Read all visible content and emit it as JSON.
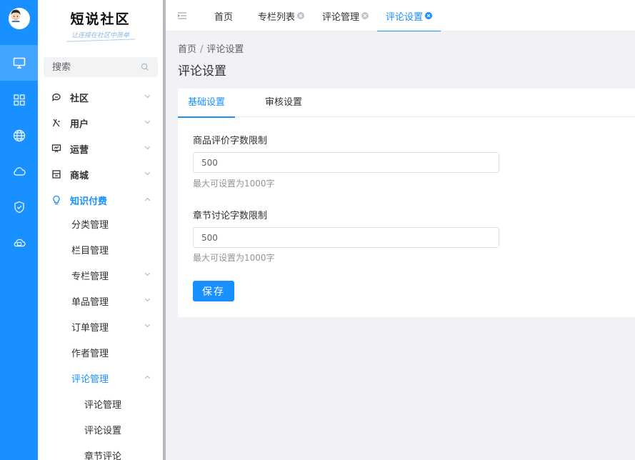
{
  "brand": {
    "title": "短说社区",
    "slogan": "让连接在社区中简单"
  },
  "search": {
    "placeholder": "搜索"
  },
  "menu": {
    "community": "社区",
    "users": "用户",
    "operations": "运营",
    "mall": "商城",
    "knowledge": "知识付费",
    "category_mgmt": "分类管理",
    "column_mgmt": "栏目管理",
    "special_mgmt": "专栏管理",
    "single_mgmt": "单品管理",
    "order_mgmt": "订单管理",
    "author_mgmt": "作者管理",
    "comment_mgmt": "评论管理",
    "comment_mgmt_child": "评论管理",
    "comment_settings": "评论设置",
    "chapter_comments": "章节评论"
  },
  "tabs": {
    "home": "首页",
    "column_list": "专栏列表",
    "comment_mgmt": "评论管理",
    "comment_settings": "评论设置"
  },
  "breadcrumb": {
    "home": "首页",
    "sep": "/",
    "current": "评论设置"
  },
  "page_title": "评论设置",
  "card_tabs": {
    "basic": "基础设置",
    "review": "审核设置"
  },
  "form": {
    "product_label": "商品评价字数限制",
    "product_value": "500",
    "product_hint": "最大可设置为1000字",
    "chapter_label": "章节讨论字数限制",
    "chapter_value": "500",
    "chapter_hint": "最大可设置为1000字",
    "save": "保存"
  },
  "colors": {
    "accent": "#1890ff",
    "rail": "#1890ff"
  },
  "icons": [
    "avatar",
    "monitor-icon",
    "grid-icon",
    "globe-icon",
    "cloud-icon",
    "shield-icon",
    "cloud-upload-icon",
    "search-icon",
    "chat-icon",
    "user-icon",
    "presentation-icon",
    "store-icon",
    "bulb-icon",
    "chevron-down-icon",
    "chevron-up-icon",
    "menu-fold-icon",
    "close-icon"
  ]
}
